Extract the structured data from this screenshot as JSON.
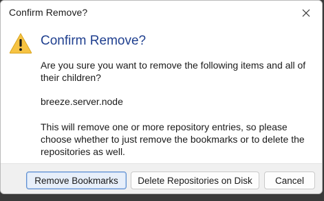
{
  "window": {
    "title": "Confirm Remove?",
    "close_icon": "close-icon"
  },
  "dialog": {
    "icon": "warning-icon",
    "heading": "Confirm Remove?",
    "question": "Are you sure you want to remove the following items and all of their children?",
    "item": "breeze.server.node",
    "explanation": "This will remove one or more repository entries, so please choose whether to just remove the bookmarks or to delete the repositories as well."
  },
  "buttons": {
    "remove_bookmarks": "Remove Bookmarks",
    "delete_repositories": "Delete Repositories on Disk",
    "cancel": "Cancel"
  },
  "colors": {
    "heading": "#1f3f8f",
    "warning_fill": "#f6c343",
    "primary_button_border": "#5e8fd0"
  }
}
